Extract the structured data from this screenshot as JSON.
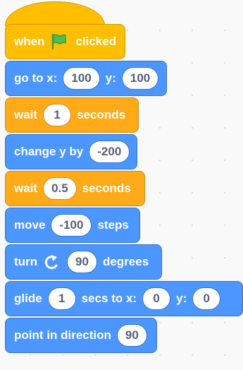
{
  "blocks": [
    {
      "words": [
        "when",
        "clicked"
      ]
    },
    {
      "words": [
        "go to x:",
        "y:"
      ],
      "values": [
        "100",
        "100"
      ]
    },
    {
      "words": [
        "wait",
        "seconds"
      ],
      "values": [
        "1"
      ]
    },
    {
      "words": [
        "change y by"
      ],
      "values": [
        "-200"
      ]
    },
    {
      "words": [
        "wait",
        "seconds"
      ],
      "values": [
        "0.5"
      ]
    },
    {
      "words": [
        "move",
        "steps"
      ],
      "values": [
        "-100"
      ]
    },
    {
      "words": [
        "turn",
        "degrees"
      ],
      "values": [
        "90"
      ]
    },
    {
      "words": [
        "glide",
        "secs to x:",
        "y:"
      ],
      "values": [
        "1",
        "0",
        "0"
      ]
    },
    {
      "words": [
        "point in direction"
      ],
      "values": [
        "90"
      ]
    }
  ],
  "colors": {
    "motion": "#4c97ff",
    "control": "#ffab19",
    "events": "#ffbf00",
    "flag": "#4cbf56"
  },
  "icons": [
    "green-flag-icon",
    "rotate-right-icon"
  ]
}
